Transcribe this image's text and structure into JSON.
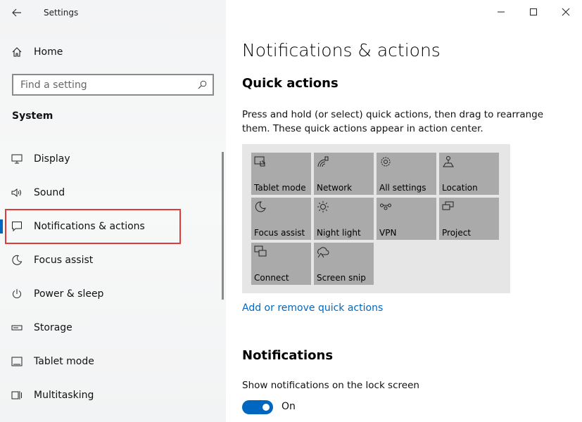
{
  "window": {
    "title": "Settings"
  },
  "sidebar": {
    "home_label": "Home",
    "search": {
      "placeholder": "Find a setting",
      "value": ""
    },
    "section_title": "System",
    "items": [
      {
        "label": "Display",
        "icon": "monitor-icon"
      },
      {
        "label": "Sound",
        "icon": "speaker-icon"
      },
      {
        "label": "Notifications & actions",
        "icon": "notification-icon",
        "active": true
      },
      {
        "label": "Focus assist",
        "icon": "moon-icon"
      },
      {
        "label": "Power & sleep",
        "icon": "power-icon"
      },
      {
        "label": "Storage",
        "icon": "storage-icon"
      },
      {
        "label": "Tablet mode",
        "icon": "tablet-icon"
      },
      {
        "label": "Multitasking",
        "icon": "multitasking-icon"
      }
    ]
  },
  "main": {
    "page_title": "Notifications & actions",
    "quick_actions": {
      "title": "Quick actions",
      "description": "Press and hold (or select) quick actions, then drag to rearrange them. These quick actions appear in action center.",
      "tiles": [
        {
          "label": "Tablet mode",
          "icon": "tablet-mode-icon"
        },
        {
          "label": "Network",
          "icon": "network-icon"
        },
        {
          "label": "All settings",
          "icon": "gear-icon"
        },
        {
          "label": "Location",
          "icon": "location-icon"
        },
        {
          "label": "Focus assist",
          "icon": "moon-icon"
        },
        {
          "label": "Night light",
          "icon": "sun-icon"
        },
        {
          "label": "VPN",
          "icon": "vpn-icon"
        },
        {
          "label": "Project",
          "icon": "project-icon"
        },
        {
          "label": "Connect",
          "icon": "connect-icon"
        },
        {
          "label": "Screen snip",
          "icon": "screen-snip-icon"
        }
      ],
      "add_remove_link": "Add or remove quick actions"
    },
    "notifications": {
      "title": "Notifications",
      "lock_screen_label": "Show notifications on the lock screen",
      "toggle_state": "On"
    }
  },
  "colors": {
    "accent": "#0067c0",
    "highlight": "#e03a3a",
    "tile": "#aaaaaa",
    "panel": "#e6e6e6"
  }
}
